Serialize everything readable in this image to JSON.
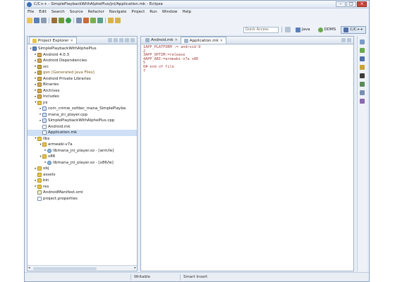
{
  "window": {
    "title": "C/C++ - SimplePlaybackWithAlphePlus/jni/Application.mk - Eclipse",
    "app_icon": "eclipse-icon"
  },
  "menubar": [
    "File",
    "Edit",
    "Search",
    "Source",
    "Refactor",
    "Navigate",
    "Project",
    "Run",
    "Window",
    "Help"
  ],
  "toolbar": {
    "icons": [
      "new-icon",
      "save-icon",
      "print-icon",
      "build-icon",
      "debug-icon",
      "run-icon",
      "search-icon",
      "navigate-back-icon",
      "navigate-forward-icon"
    ]
  },
  "perspectives": {
    "quick_access": "Quick Access",
    "items": [
      {
        "label": "Java",
        "icon": "java-perspective-icon",
        "active": false
      },
      {
        "label": "DDMS",
        "icon": "ddms-perspective-icon",
        "active": false
      },
      {
        "label": "C/C++",
        "icon": "cpp-perspective-icon",
        "active": true
      }
    ]
  },
  "project_explorer": {
    "tab_label": "Project Explorer",
    "tree": [
      {
        "label": "SimplePlaybackWithAlphePlus",
        "depth": 0,
        "arrow": "▾",
        "icon": "project"
      },
      {
        "label": "Android 4.0.3",
        "depth": 1,
        "arrow": "▸",
        "icon": "lib"
      },
      {
        "label": "Android Dependencies",
        "depth": 1,
        "arrow": "▸",
        "icon": "lib"
      },
      {
        "label": "src",
        "depth": 1,
        "arrow": "▸",
        "icon": "src"
      },
      {
        "label": "gen [Generated Java Files]",
        "depth": 1,
        "arrow": "▸",
        "icon": "src",
        "label_color": "#7a5a20"
      },
      {
        "label": "Android Private Libraries",
        "depth": 1,
        "arrow": "▸",
        "icon": "lib"
      },
      {
        "label": "Binaries",
        "depth": 1,
        "arrow": "▸",
        "icon": "lib"
      },
      {
        "label": "Archives",
        "depth": 1,
        "arrow": "▸",
        "icon": "lib"
      },
      {
        "label": "Includes",
        "depth": 1,
        "arrow": "▸",
        "icon": "lib"
      },
      {
        "label": "jni",
        "depth": 1,
        "arrow": "▾",
        "icon": "folder"
      },
      {
        "label": "com_crimw_sofdec_mana_SimplePlayba",
        "depth": 2,
        "arrow": "▸",
        "icon": "cpp"
      },
      {
        "label": "mana_jni_player.cpp",
        "depth": 2,
        "arrow": "▸",
        "icon": "cpp"
      },
      {
        "label": "SimplePlaybackWithAlphePlus.cpp",
        "depth": 2,
        "arrow": "▸",
        "icon": "cpp"
      },
      {
        "label": "Android.mk",
        "depth": 2,
        "arrow": "",
        "icon": "file"
      },
      {
        "label": "Application.mk",
        "depth": 2,
        "arrow": "",
        "icon": "file",
        "selected": true
      },
      {
        "label": "libs",
        "depth": 1,
        "arrow": "▾",
        "icon": "folder"
      },
      {
        "label": "armeabi-v7a",
        "depth": 2,
        "arrow": "▾",
        "icon": "folder"
      },
      {
        "label": "libmana_jni_player.so - [arm/le]",
        "depth": 3,
        "arrow": "▸",
        "icon": "so"
      },
      {
        "label": "x86",
        "depth": 2,
        "arrow": "▾",
        "icon": "folder"
      },
      {
        "label": "libmana_jni_player.so - [x86/le]",
        "depth": 3,
        "arrow": "▸",
        "icon": "so"
      },
      {
        "label": "obj",
        "depth": 1,
        "arrow": "▸",
        "icon": "folder"
      },
      {
        "label": "assets",
        "depth": 1,
        "arrow": "",
        "icon": "folder"
      },
      {
        "label": "bin",
        "depth": 1,
        "arrow": "▸",
        "icon": "folder"
      },
      {
        "label": "res",
        "depth": 1,
        "arrow": "▸",
        "icon": "folder"
      },
      {
        "label": "AndroidManifest.xml",
        "depth": 1,
        "arrow": "",
        "icon": "xml"
      },
      {
        "label": "project.properties",
        "depth": 1,
        "arrow": "",
        "icon": "file"
      }
    ]
  },
  "editor": {
    "tabs": [
      {
        "label": "Android.mk",
        "active": false
      },
      {
        "label": "Application.mk",
        "active": true
      }
    ],
    "lines": [
      {
        "text": "1APP_PLATFORM := android-9",
        "style": "num"
      },
      {
        "text": "2",
        "style": "num"
      },
      {
        "text": "3APP_OPTIM:=release",
        "style": "num"
      },
      {
        "text": "4APP_ABI:=armeabi-v7a x86",
        "style": "num"
      },
      {
        "text": "5",
        "style": "num"
      },
      {
        "text": "6# end of file",
        "style": "comment"
      },
      {
        "text": "7",
        "style": "num"
      }
    ]
  },
  "right_trim": {
    "icons": [
      "outline-icon",
      "tasks-icon",
      "console-icon",
      "problems-icon",
      "bookmark-icon",
      "make-target-icon",
      "search-view-icon",
      "call-hierarchy-icon"
    ]
  },
  "statusbar": {
    "writable": "Writable",
    "insert_mode": "Smart Insert"
  }
}
